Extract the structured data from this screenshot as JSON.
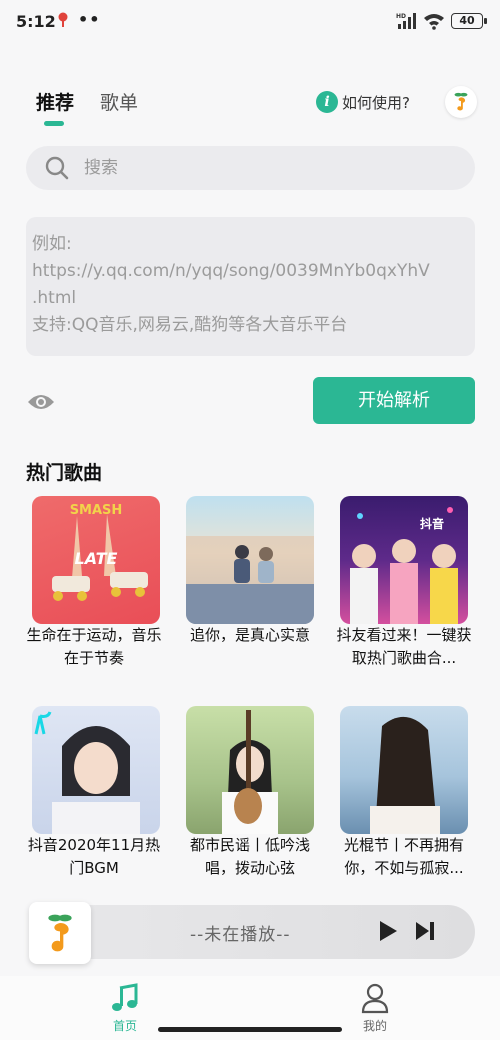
{
  "status_bar": {
    "time": "5:12",
    "dots": "••",
    "battery": "40",
    "network": "HD"
  },
  "tabs": [
    {
      "label": "推荐"
    },
    {
      "label": "歌单"
    }
  ],
  "help": {
    "icon": "i",
    "label": "如何使用?"
  },
  "search": {
    "placeholder": "搜索"
  },
  "link_box": {
    "line1": "例如:",
    "line2": "https://y.qq.com/n/yqq/song/0039MnYb0qxYhV",
    "line3": ".html",
    "line4": " 支持:QQ音乐,网易云,酷狗等各大音乐平台"
  },
  "parse_button": "开始解析",
  "section_title": "热门歌曲",
  "songs": [
    {
      "title_line1": "生命在于运动，音乐",
      "title_line2": "在于节奏",
      "cover_text": "SMASH"
    },
    {
      "title_line1": "追你，是真心实意",
      "title_line2": ""
    },
    {
      "title_line1": "抖友看过来！一键获",
      "title_line2": "取热门歌曲合...",
      "cover_text": "抖音"
    },
    {
      "title_line1": "抖音2020年11月热",
      "title_line2": "门BGM"
    },
    {
      "title_line1": "都市民谣丨低吟浅",
      "title_line2": "唱，拨动心弦"
    },
    {
      "title_line1": "光棍节丨不再拥有",
      "title_line2": "你，不如与孤寂..."
    }
  ],
  "player": {
    "status": "--未在播放--"
  },
  "nav": {
    "home": "首页",
    "mine": "我的"
  },
  "colors": {
    "accent": "#2bb794"
  }
}
